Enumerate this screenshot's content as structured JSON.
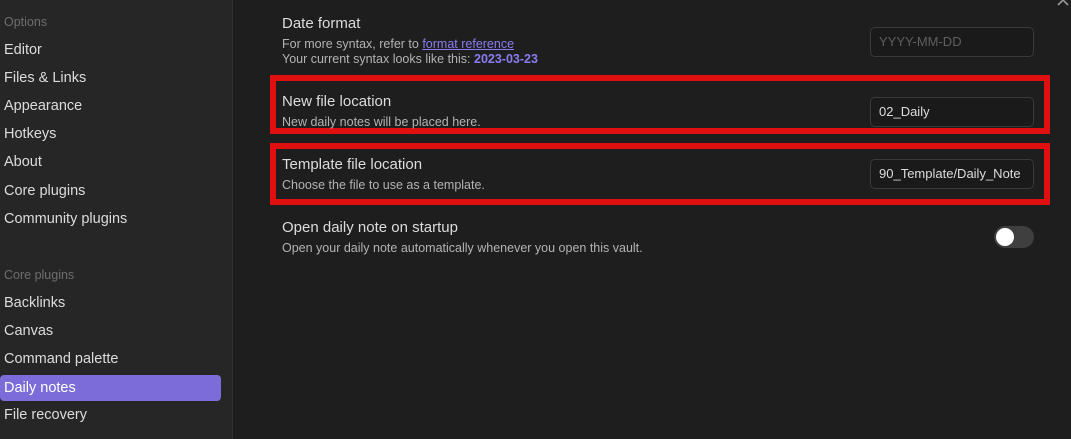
{
  "sidebar": {
    "options_title": "Options",
    "options_items": [
      {
        "label": "Editor"
      },
      {
        "label": "Files & Links"
      },
      {
        "label": "Appearance"
      },
      {
        "label": "Hotkeys"
      },
      {
        "label": "About"
      },
      {
        "label": "Core plugins"
      },
      {
        "label": "Community plugins"
      }
    ],
    "core_plugins_title": "Core plugins",
    "core_plugin_items": [
      {
        "label": "Backlinks"
      },
      {
        "label": "Canvas"
      },
      {
        "label": "Command palette"
      },
      {
        "label": "Daily notes",
        "active": true
      },
      {
        "label": "File recovery"
      }
    ]
  },
  "settings": {
    "date_format": {
      "title": "Date format",
      "desc_prefix": "For more syntax, refer to ",
      "desc_link": "format reference",
      "desc_line2_prefix": "Your current syntax looks like this: ",
      "current_value": "2023-03-23",
      "placeholder": "YYYY-MM-DD"
    },
    "new_file_location": {
      "title": "New file location",
      "desc": "New daily notes will be placed here.",
      "value": "02_Daily"
    },
    "template_file_location": {
      "title": "Template file location",
      "desc": "Choose the file to use as a template.",
      "value": "90_Template/Daily_Note"
    },
    "open_on_startup": {
      "title": "Open daily note on startup",
      "desc": "Open your daily note automatically whenever you open this vault.",
      "enabled": false
    }
  },
  "colors": {
    "accent": "#7b6cd9",
    "highlight": "#e01010"
  }
}
